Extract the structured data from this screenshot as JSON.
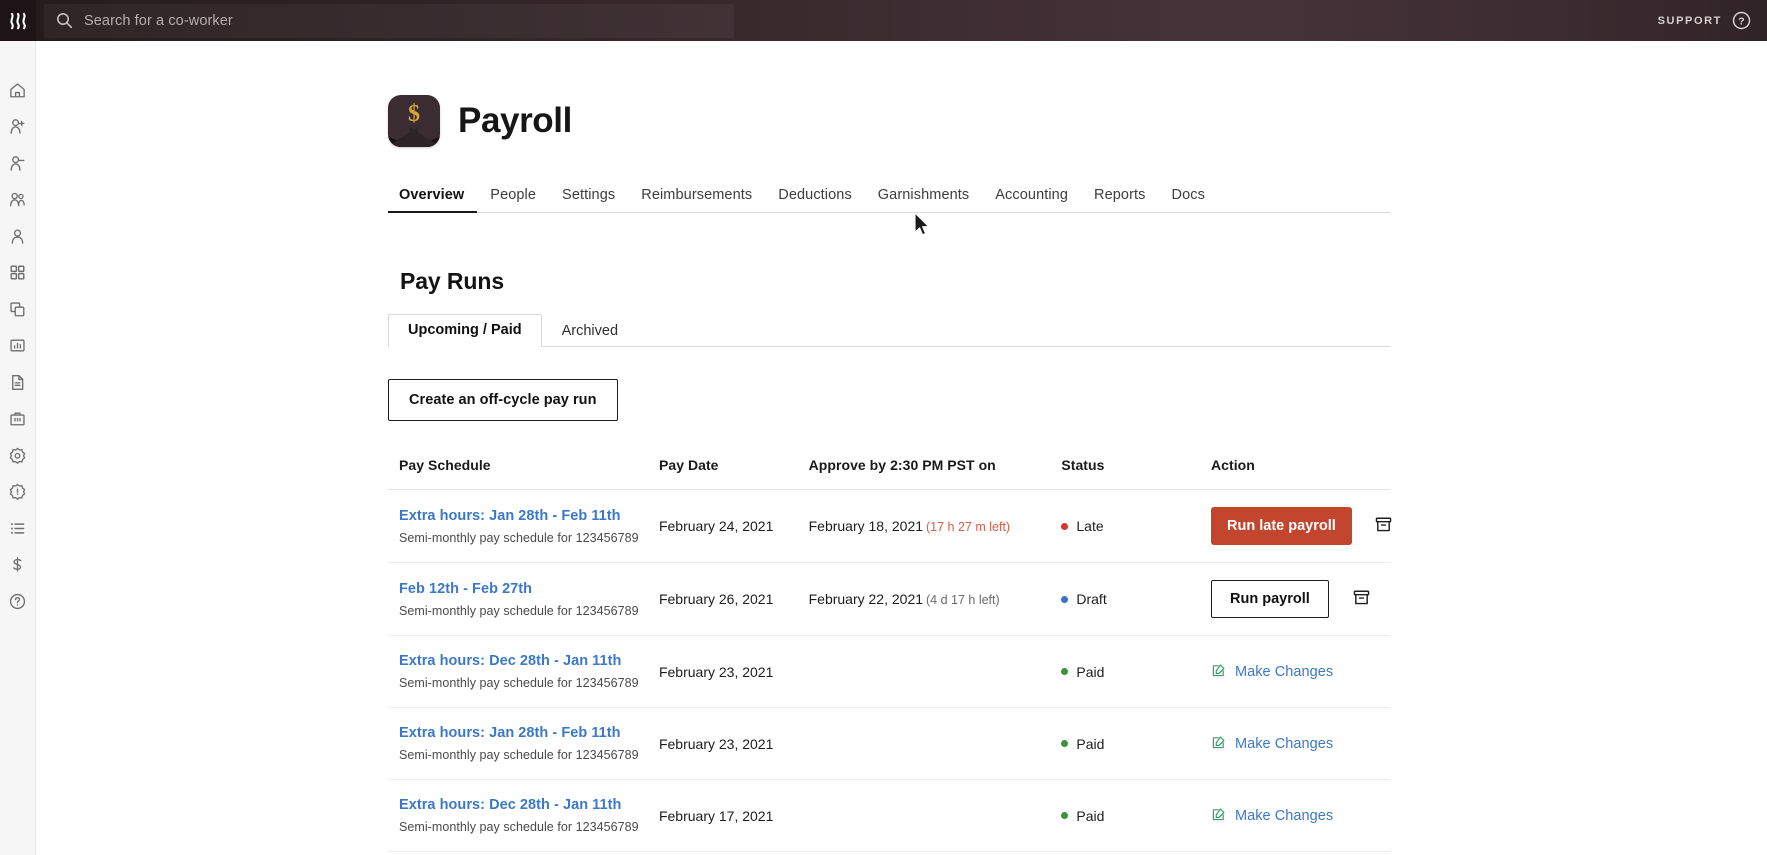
{
  "topbar": {
    "brand_icon": "rippling-logo-icon",
    "search": {
      "icon": "search-icon",
      "placeholder": "Search for a co-worker",
      "value": ""
    },
    "support_label": "SUPPORT",
    "help_icon": "question-circle-icon"
  },
  "sidebar": {
    "items": [
      {
        "icon": "home-icon",
        "name": "sidebar-item-home"
      },
      {
        "icon": "user-add-icon",
        "name": "sidebar-item-hire"
      },
      {
        "icon": "user-remove-icon",
        "name": "sidebar-item-terminate"
      },
      {
        "icon": "users-group-icon",
        "name": "sidebar-item-team"
      },
      {
        "icon": "user-icon",
        "name": "sidebar-item-profile"
      },
      {
        "icon": "grid-apps-icon",
        "name": "sidebar-item-apps"
      },
      {
        "icon": "layers-icon",
        "name": "sidebar-item-devices"
      },
      {
        "icon": "chart-box-icon",
        "name": "sidebar-item-analytics"
      },
      {
        "icon": "document-icon",
        "name": "sidebar-item-documents"
      },
      {
        "icon": "briefcase-icon",
        "name": "sidebar-item-company"
      },
      {
        "icon": "gear-target-icon",
        "name": "sidebar-item-settings"
      },
      {
        "icon": "gear-alert-icon",
        "name": "sidebar-item-admin"
      },
      {
        "icon": "list-icon",
        "name": "sidebar-item-tasks"
      },
      {
        "icon": "money-icon",
        "name": "sidebar-item-payroll"
      },
      {
        "icon": "help-circle-icon",
        "name": "sidebar-item-help"
      }
    ]
  },
  "app": {
    "icon": "payroll-app-icon",
    "icon_symbol": "$",
    "title": "Payroll"
  },
  "nav_tabs": [
    {
      "label": "Overview",
      "active": true
    },
    {
      "label": "People",
      "active": false
    },
    {
      "label": "Settings",
      "active": false
    },
    {
      "label": "Reimbursements",
      "active": false
    },
    {
      "label": "Deductions",
      "active": false
    },
    {
      "label": "Garnishments",
      "active": false
    },
    {
      "label": "Accounting",
      "active": false
    },
    {
      "label": "Reports",
      "active": false
    },
    {
      "label": "Docs",
      "active": false
    }
  ],
  "section": {
    "title": "Pay Runs",
    "sub_tabs": [
      {
        "label": "Upcoming / Paid",
        "active": true
      },
      {
        "label": "Archived",
        "active": false
      }
    ],
    "create_button": "Create an off-cycle pay run"
  },
  "table": {
    "headers": {
      "pay_schedule": "Pay Schedule",
      "pay_date": "Pay Date",
      "approve_by": "Approve by 2:30 PM PST on",
      "status": "Status",
      "action": "Action"
    },
    "rows": [
      {
        "schedule_link": "Extra hours: Jan 28th - Feb 11th",
        "schedule_sub": "Semi-monthly pay schedule for 123456789",
        "pay_date": "February 24, 2021",
        "approve_date": "February 18, 2021",
        "approve_left": "(17 h 27 m left)",
        "approve_left_style": "warn",
        "status": "Late",
        "status_color": "#d0392b",
        "action_type": "danger-button",
        "action_label": "Run late payroll",
        "has_archive": true,
        "archive_icon": "archive-box-icon"
      },
      {
        "schedule_link": "Feb 12th - Feb 27th",
        "schedule_sub": "Semi-monthly pay schedule for 123456789",
        "pay_date": "February 26, 2021",
        "approve_date": "February 22, 2021",
        "approve_left": "(4 d 17 h left)",
        "approve_left_style": "norm",
        "status": "Draft",
        "status_color": "#3b6fd4",
        "action_type": "outline-button",
        "action_label": "Run payroll",
        "has_archive": true,
        "archive_icon": "archive-box-icon"
      },
      {
        "schedule_link": "Extra hours: Dec 28th - Jan 11th",
        "schedule_sub": "Semi-monthly pay schedule for 123456789",
        "pay_date": "February 23, 2021",
        "approve_date": "",
        "approve_left": "",
        "approve_left_style": "norm",
        "status": "Paid",
        "status_color": "#3f9142",
        "action_type": "link",
        "action_label": "Make Changes",
        "action_icon": "edit-square-icon",
        "has_archive": false
      },
      {
        "schedule_link": "Extra hours: Jan 28th - Feb 11th",
        "schedule_sub": "Semi-monthly pay schedule for 123456789",
        "pay_date": "February 23, 2021",
        "approve_date": "",
        "approve_left": "",
        "approve_left_style": "norm",
        "status": "Paid",
        "status_color": "#3f9142",
        "action_type": "link",
        "action_label": "Make Changes",
        "action_icon": "edit-square-icon",
        "has_archive": false
      },
      {
        "schedule_link": "Extra hours: Dec 28th - Jan 11th",
        "schedule_sub": "Semi-monthly pay schedule for 123456789",
        "pay_date": "February 17, 2021",
        "approve_date": "",
        "approve_left": "",
        "approve_left_style": "norm",
        "status": "Paid",
        "status_color": "#3f9142",
        "action_type": "link",
        "action_label": "Make Changes",
        "action_icon": "edit-square-icon",
        "has_archive": false
      }
    ]
  },
  "colors": {
    "topbar_bg": "#2b1f22",
    "accent_link": "#3c78c8",
    "danger": "#c2452e",
    "gold": "#d7a635"
  }
}
